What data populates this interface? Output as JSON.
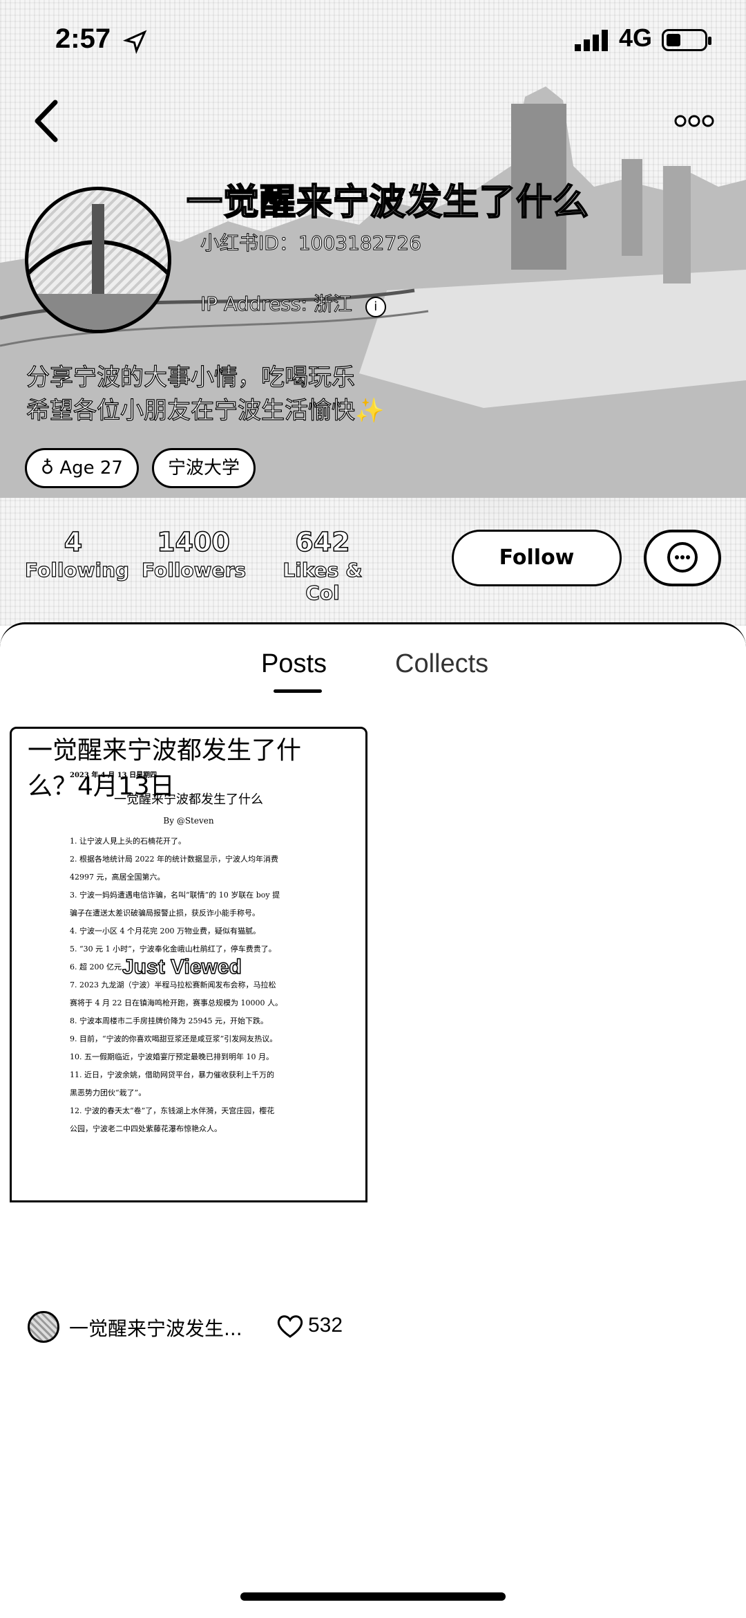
{
  "status_bar": {
    "time": "2:57",
    "network": "4G"
  },
  "profile": {
    "name": "一觉醒来宁波发生了什么",
    "xhs_id": "小红书ID：1003182726",
    "ip_address": "IP Address: 浙江",
    "bio_line1": "分享宁波的大事小情，吃喝玩乐",
    "bio_line2": "希望各位小朋友在宁波生活愉快✨",
    "tags": [
      "Age 27",
      "宁波大学"
    ]
  },
  "stats": {
    "following_num": "4",
    "following_label": "Following",
    "followers_num": "1400",
    "followers_label": "Followers",
    "likes_num": "642",
    "likes_label": "Likes & Col"
  },
  "actions": {
    "follow": "Follow"
  },
  "tabs": [
    "Posts",
    "Collects"
  ],
  "post": {
    "doc_date": "2023 年 4 月 13 日星期四",
    "doc_title": "一觉醒来宁波都发生了什么",
    "doc_by": "By @Steven",
    "doc_lines": [
      "1. 让宁波人見上头的石楠花开了。",
      "2. 根据各地统计局 2022 年的统计数据显示，宁波人均年消费",
      "42997 元，高居全国第六。",
      "3. 宁波一妈妈遭遇电信诈骗，名叫“联情”的 10 岁联在 boy 提",
      "骗子在遭送太差识破骗局报警止损，获反诈小能手称号。",
      "4. 宁波一小区 4 个月花完 200 万物业费，疑似有猫腻。",
      "5. “30 元 1 小时”，宁波奉化金峨山杜鹃红了，停车费贵了。",
      "6. 超 200 亿元",
      "7. 2023 九龙湖（宁波）半程马拉松赛新闻发布会称，马拉松",
      "赛将于 4 月 22 日在镇海鸣枪开跑，赛事总规模为 10000 人。",
      "8. 宁波本周楼市二手房挂牌价降为 25945 元，开始下跌。",
      "9. 目前，“宁波的你喜欢喝甜豆浆还是咸豆浆”引发网友热议。",
      "10. 五一假期临近，宁波婚宴厅预定最晚已排到明年 10 月。",
      "11. 近日，宁波余姚，借助网贷平台，暴力催收获利上千万的",
      "黑恶势力团伙“栽了”。",
      "12. 宁波的春天太“卷”了，东钱湖上水伴漪，天宫庄园，樱花",
      "公园，宁波老二中四处紫藤花瀑布惊艳众人。"
    ],
    "just_viewed": "Just Viewed",
    "title": "一觉醒来宁波都发生了什么？4月13日",
    "author": "一觉醒来宁波发生...",
    "likes": "532"
  }
}
